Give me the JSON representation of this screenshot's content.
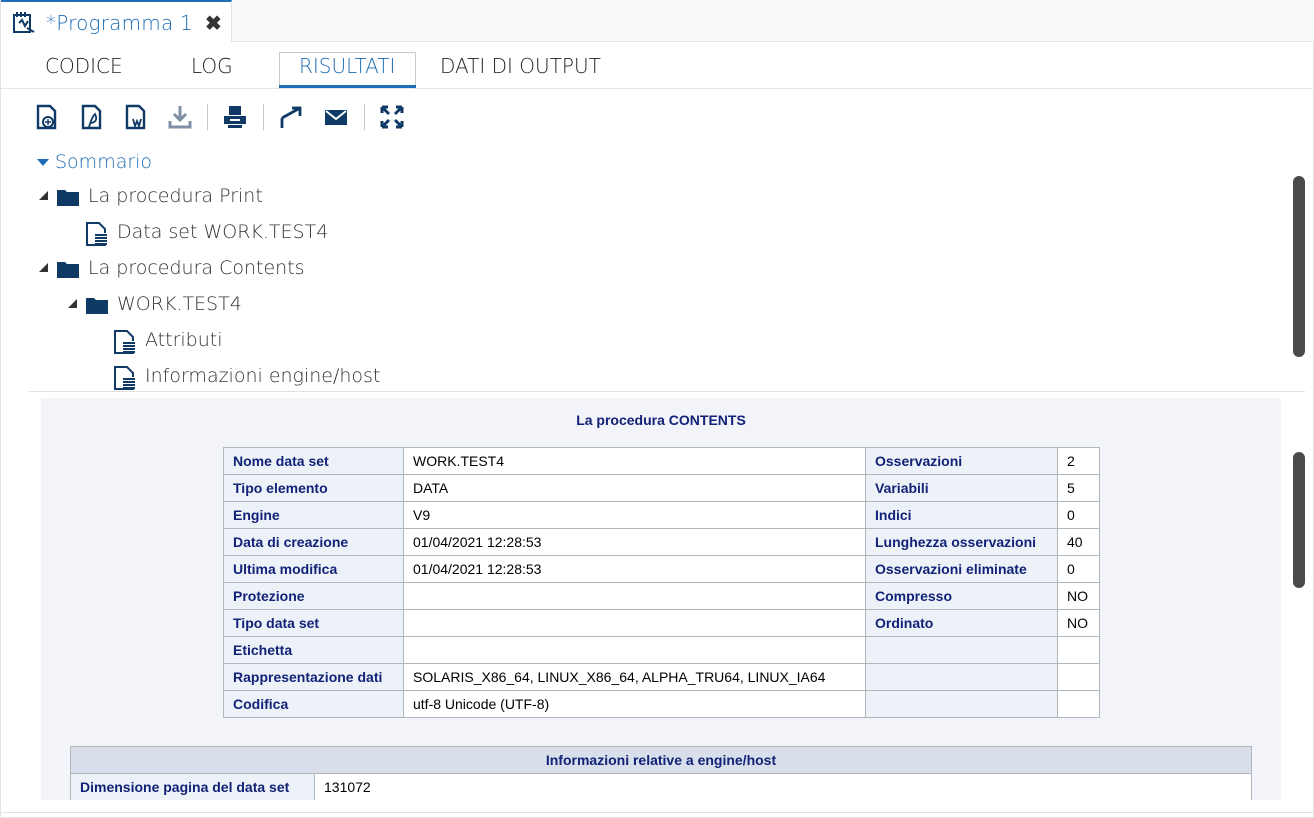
{
  "window": {
    "program_tab": "*Programma 1",
    "close_glyph": "✖"
  },
  "tabs": [
    {
      "label": "CODICE"
    },
    {
      "label": "LOG"
    },
    {
      "label": "RISULTATI"
    },
    {
      "label": "DATI DI OUTPUT"
    }
  ],
  "toolbar": {
    "icons": [
      "html-download-icon",
      "pdf-download-icon",
      "word-download-icon",
      "download-icon",
      "print-icon",
      "open-new-window-icon",
      "email-icon",
      "maximize-icon"
    ]
  },
  "tree": {
    "summary": "Sommario",
    "print_proc": "La procedura Print",
    "print_dataset": "Data set WORK.TEST4",
    "contents_proc": "La procedura Contents",
    "contents_dataset": "WORK.TEST4",
    "attributes": "Attributi",
    "engine_info": "Informazioni engine/host"
  },
  "results": {
    "title": "La procedura CONTENTS",
    "rows": [
      {
        "k1": "Nome data set",
        "v1": "WORK.TEST4",
        "k2": "Osservazioni",
        "v2": "2"
      },
      {
        "k1": "Tipo elemento",
        "v1": "DATA",
        "k2": "Variabili",
        "v2": "5"
      },
      {
        "k1": "Engine",
        "v1": "V9",
        "k2": "Indici",
        "v2": "0"
      },
      {
        "k1": "Data di creazione",
        "v1": "01/04/2021 12:28:53",
        "k2": "Lunghezza osservazioni",
        "v2": "40"
      },
      {
        "k1": "Ultima modifica",
        "v1": "01/04/2021 12:28:53",
        "k2": "Osservazioni eliminate",
        "v2": "0"
      },
      {
        "k1": "Protezione",
        "v1": "",
        "k2": "Compresso",
        "v2": "NO"
      },
      {
        "k1": "Tipo data set",
        "v1": "",
        "k2": "Ordinato",
        "v2": "NO"
      },
      {
        "k1": "Etichetta",
        "v1": "",
        "k2": "",
        "v2": ""
      },
      {
        "k1": "Rappresentazione dati",
        "v1": "SOLARIS_X86_64, LINUX_X86_64, ALPHA_TRU64, LINUX_IA64",
        "k2": "",
        "v2": ""
      },
      {
        "k1": "Codifica",
        "v1": "utf-8 Unicode (UTF-8)",
        "k2": "",
        "v2": ""
      }
    ],
    "engine_title": "Informazioni relative a engine/host",
    "engine_rows": [
      {
        "k": "Dimensione pagina del data set",
        "v": "131072"
      }
    ]
  },
  "colors": {
    "accent": "#1f6db5",
    "folder": "#0f3a66",
    "header_text": "#112277",
    "header_bg": "#edf2f9"
  }
}
